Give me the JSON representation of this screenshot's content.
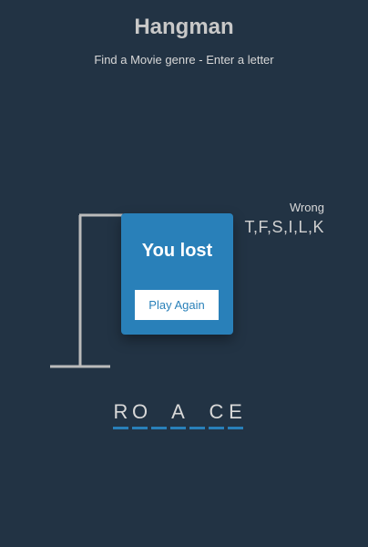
{
  "header": {
    "title": "Hangman",
    "subtitle": "Find a Movie genre - Enter a letter"
  },
  "wrong": {
    "label": "Wrong",
    "letters": "T,F,S,I,L,K"
  },
  "popup": {
    "message": "You lost",
    "button_label": "Play Again"
  },
  "word": {
    "slots": [
      "R",
      "O",
      "",
      "A",
      "",
      "C",
      "E"
    ]
  },
  "colors": {
    "background": "#223344",
    "accent": "#2980b9",
    "gallows": "#bbbbbb"
  }
}
